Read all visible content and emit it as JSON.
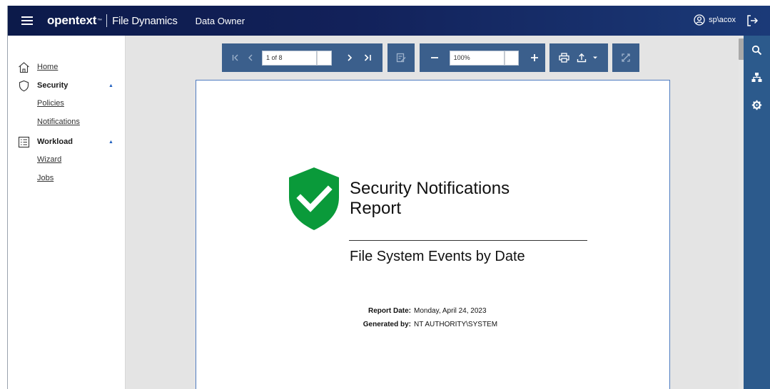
{
  "header": {
    "brand": "opentext",
    "brand_mark": "™",
    "product": "File Dynamics",
    "module": "Data Owner",
    "user": "sp\\acox"
  },
  "sidebar": {
    "home": "Home",
    "security": {
      "label": "Security",
      "items": [
        "Policies",
        "Notifications"
      ]
    },
    "workload": {
      "label": "Workload",
      "items": [
        "Wizard",
        "Jobs"
      ]
    }
  },
  "toolbar": {
    "page_field": "1 of 8",
    "zoom_field": "100%"
  },
  "report": {
    "title_line1": "Security Notifications",
    "title_line2": "Report",
    "subtitle": "File System Events by Date",
    "report_date_label": "Report Date:",
    "report_date_value": "Monday, April 24, 2023",
    "generated_by_label": "Generated by:",
    "generated_by_value": "NT AUTHORITY\\SYSTEM"
  },
  "colors": {
    "header_start": "#0c1a4a",
    "header_end": "#1b3a78",
    "toolbar": "#3b5f8c",
    "rail": "#2c5a8c",
    "shield": "#0a9a3a",
    "accent": "#1f5fbf"
  },
  "icons": {
    "menu": "hamburger-icon",
    "user": "user-circle-icon",
    "logout": "logout-icon",
    "home": "home-icon",
    "security": "shield-outline-icon",
    "workload": "list-icon",
    "rail": [
      "search-icon",
      "sitemap-icon",
      "gear-icon"
    ]
  }
}
